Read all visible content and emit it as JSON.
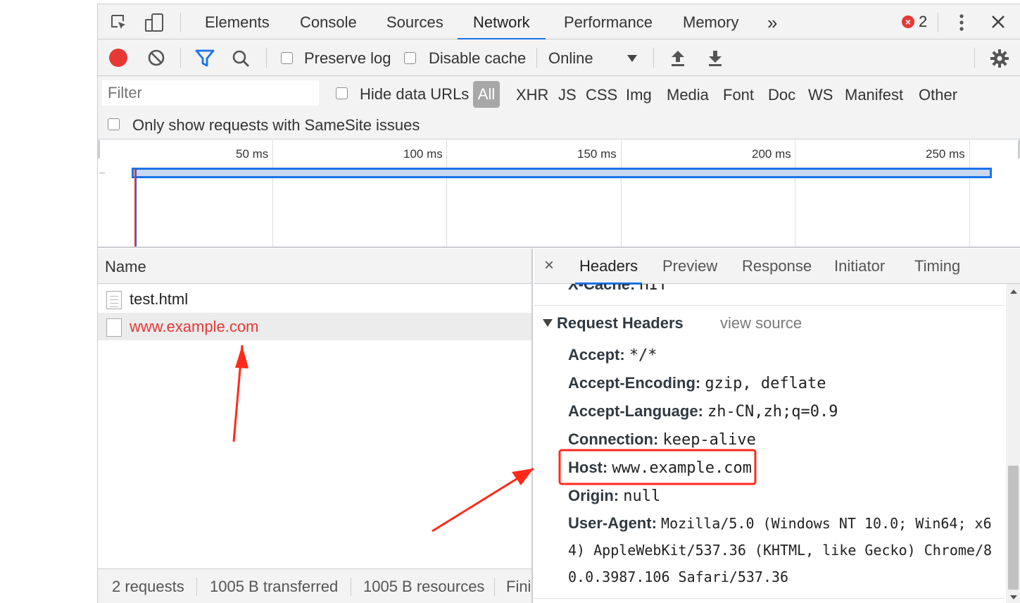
{
  "toolbar": {
    "tabs": [
      "Elements",
      "Console",
      "Sources",
      "Network",
      "Performance",
      "Memory"
    ],
    "more_label": "»",
    "error_count": "2",
    "active_tab": "Network"
  },
  "network_toolbar": {
    "preserve_log": "Preserve log",
    "disable_cache": "Disable cache",
    "throttle": "Online"
  },
  "filter": {
    "placeholder": "Filter",
    "hide_data_urls": "Hide data URLs",
    "types": [
      "All",
      "XHR",
      "JS",
      "CSS",
      "Img",
      "Media",
      "Font",
      "Doc",
      "WS",
      "Manifest",
      "Other"
    ],
    "samesite": "Only show requests with SameSite issues"
  },
  "overview": {
    "ticks": [
      "50 ms",
      "100 ms",
      "150 ms",
      "200 ms",
      "250 ms"
    ]
  },
  "requests": {
    "column": "Name",
    "rows": [
      {
        "name": "test.html",
        "status": "ok"
      },
      {
        "name": "www.example.com",
        "status": "error"
      }
    ],
    "status": {
      "requests": "2 requests",
      "transferred": "1005 B transferred",
      "resources": "1005 B resources",
      "finish": "Fini"
    }
  },
  "details": {
    "close": "×",
    "tabs": [
      "Headers",
      "Preview",
      "Response",
      "Initiator",
      "Timing"
    ],
    "active_tab": "Headers",
    "partial_header": {
      "key": "X-Cache:",
      "value": "HIT"
    },
    "section_title": "Request Headers",
    "view_source": "view source",
    "headers": [
      {
        "key": "Accept:",
        "value": "*/*"
      },
      {
        "key": "Accept-Encoding:",
        "value": "gzip, deflate"
      },
      {
        "key": "Accept-Language:",
        "value": "zh-CN,zh;q=0.9"
      },
      {
        "key": "Connection:",
        "value": "keep-alive"
      },
      {
        "key": "Host:",
        "value": "www.example.com"
      },
      {
        "key": "Origin:",
        "value": "null"
      },
      {
        "key": "User-Agent:",
        "value": "Mozilla/5.0 (Windows NT 10.0; Win64; x6"
      }
    ],
    "user_agent_cont": [
      "4) AppleWebKit/537.36 (KHTML, like Gecko) Chrome/8",
      "0.0.3987.106 Safari/537.36"
    ]
  },
  "colors": {
    "accent": "#1a73e8",
    "error": "#e53935",
    "annotation": "#ff2a1a"
  }
}
